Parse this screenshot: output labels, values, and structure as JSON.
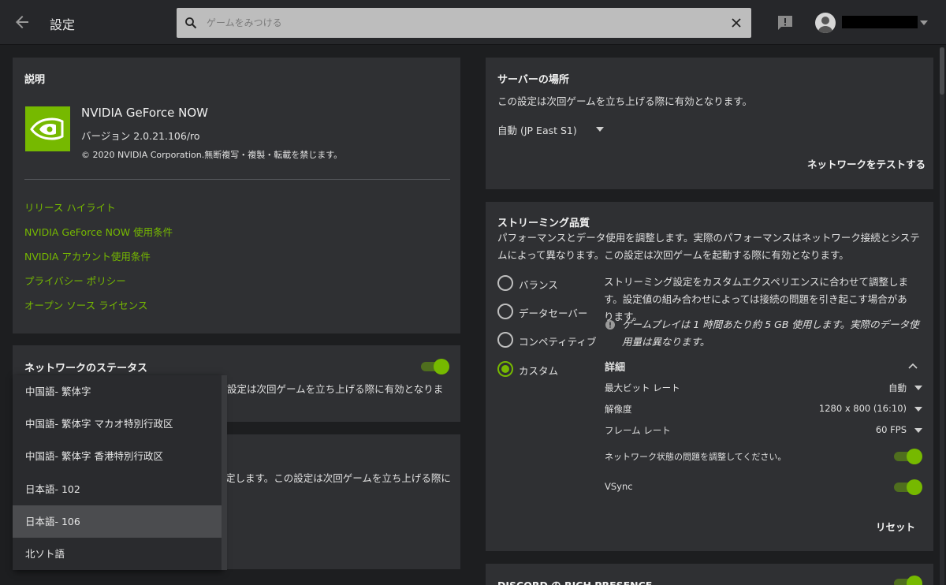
{
  "topbar": {
    "title": "設定",
    "search_placeholder": "ゲームをみつける"
  },
  "about": {
    "heading": "説明",
    "app_name": "NVIDIA GeForce NOW",
    "version": "バージョン 2.0.21.106/ro",
    "copyright": "© 2020 NVIDIA Corporation.無断複写・複製・転載を禁じます。",
    "links": [
      "リリース ハイライト",
      "NVIDIA GeForce NOW 使用条件",
      "NVIDIA アカウント使用条件",
      "プライバシー ポリシー",
      "オープン ソース ライセンス"
    ]
  },
  "network_status": {
    "heading": "ネットワークのステータス",
    "desc_partial": "設定は次回ゲームを立ち上げる際に有効となりま",
    "toggle_on": true
  },
  "language": {
    "desc_partial": "定します。この設定は次回ゲームを立ち上げる際に"
  },
  "language_dropdown": {
    "items": [
      "中国語- 繁体字",
      "中国語- 繁体字 マカオ特別行政区",
      "中国語- 繁体字 香港特別行政区",
      "日本語- 102",
      "日本語- 106",
      "北ソト語"
    ],
    "selected_index": 4
  },
  "server": {
    "heading": "サーバーの場所",
    "desc": "この設定は次回ゲームを立ち上げる際に有効となります。",
    "location": "自動 (JP East S1)",
    "test_button": "ネットワークをテストする"
  },
  "streaming": {
    "heading": "ストリーミング品質",
    "desc": "パフォーマンスとデータ使用を調整します。実際のパフォーマンスはネットワーク接続とシステムによって異なります。この設定は次回ゲームを起動する際に有効となります。",
    "options": [
      "バランス",
      "データセーバー",
      "コンペティティブ",
      "カスタム"
    ],
    "selected": "カスタム",
    "custom_desc": "ストリーミング設定をカスタムエクスペリエンスに合わせて調整します。設定値の組み合わせによっては接続の問題を引き起こす場合があります。",
    "info": "ゲームプレイは 1 時間あたり約 5 GB 使用します。実際のデータ使用量は異なります。",
    "details_label": "詳細",
    "bitrate_label": "最大ビット レート",
    "bitrate_value": "自動",
    "resolution_label": "解像度",
    "resolution_value": "1280 x 800 (16:10)",
    "framerate_label": "フレーム レート",
    "framerate_value": "60 FPS",
    "network_adjust_label": "ネットワーク状態の問題を調整してください。",
    "network_adjust_on": true,
    "vsync_label": "VSync",
    "vsync_on": true,
    "reset_button": "リセット"
  },
  "discord": {
    "heading": "DISCORD の RICH PRESENCE"
  },
  "colors": {
    "accent": "#76b900",
    "panel": "#2f3033",
    "background": "#1d1e20"
  }
}
